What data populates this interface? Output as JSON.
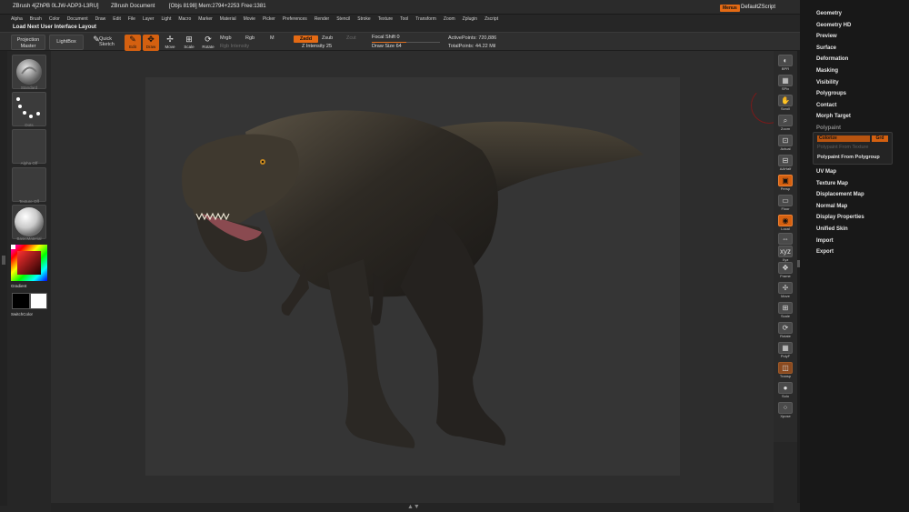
{
  "title_bar": {
    "app": "ZBrush  4[ZhPB 0LJW-ADP3-L3RU]",
    "document": "ZBrush Document",
    "stats": "[Objs 8198] Mem:2794+2253  Free:1381",
    "menus_badge": "Menus",
    "default_script": "DefaultZScript"
  },
  "menubar": [
    "Alpha",
    "Brush",
    "Color",
    "Document",
    "Draw",
    "Edit",
    "File",
    "Layer",
    "Light",
    "Macro",
    "Marker",
    "Material",
    "Movie",
    "Picker",
    "Preferences",
    "Render",
    "Stencil",
    "Stroke",
    "Texture",
    "Tool",
    "Transform",
    "Zoom",
    "Zplugin",
    "Zscript"
  ],
  "layout_label": "Load Next User Interface Layout",
  "toolbar": {
    "projection_master": "Projection Master",
    "lightbox": "LightBox",
    "quick_sketch": "Quick Sketch",
    "edit": "Edit",
    "draw": "Draw",
    "move": "Move",
    "scale": "Scale",
    "rotate": "Rotate",
    "mrgb": "Mrgb",
    "rgb": "Rgb",
    "m": "M",
    "zadd": "Zadd",
    "zsub": "Zsub",
    "zcut": "Zcut",
    "rgb_intensity": "Rgb Intensity",
    "z_intensity_label": "Z Intensity",
    "z_intensity_value": "25",
    "focal_shift_label": "Focal Shift",
    "focal_shift_value": "0",
    "draw_size_label": "Draw Size",
    "draw_size_value": "64",
    "active_points": "ActivePoints: 720,886",
    "total_points": "TotalPoints: 44.22 Mil"
  },
  "left_shelf": {
    "standard": "Standard",
    "dots": "Dots",
    "alpha_off": "Alpha  Off",
    "texture_off": "Texture  Off",
    "material": "BasicMaterial",
    "gradient": "Gradient",
    "switch_color": "SwitchColor"
  },
  "right_shelf": [
    "BPR",
    "SPix",
    "Scroll",
    "Zoom",
    "Actual",
    "AAHalf",
    "Persp",
    "Floor",
    "Local",
    "L.Sym",
    "Xyz",
    "Frame",
    "Move",
    "Scale",
    "Rotate",
    "PolyF",
    "Transp",
    "Solo",
    "Xpose"
  ],
  "palette": {
    "items": [
      "Geometry",
      "Geometry HD",
      "Preview",
      "Surface",
      "Deformation",
      "Masking",
      "Visibility",
      "Polygroups",
      "Contact",
      "Morph Target",
      "Polypaint"
    ],
    "items_after": [
      "UV Map",
      "Texture Map",
      "Displacement Map",
      "Normal Map",
      "Display Properties",
      "Unified Skin",
      "Import",
      "Export"
    ],
    "polypaint": {
      "colorize": "Colorize",
      "grd": "Grd",
      "from_texture": "Polypaint From Texture",
      "from_polygroup": "Polypaint From Polygroup"
    }
  },
  "colors": {
    "accent": "#e46a14",
    "panel": "#181818",
    "canvas": "#353535"
  },
  "icons": [
    "sphere-brush-icon",
    "dots-stroke-icon",
    "color-picker-icon",
    "dinosaur-model",
    "zoom-icon",
    "move-icon",
    "rotate-icon"
  ]
}
